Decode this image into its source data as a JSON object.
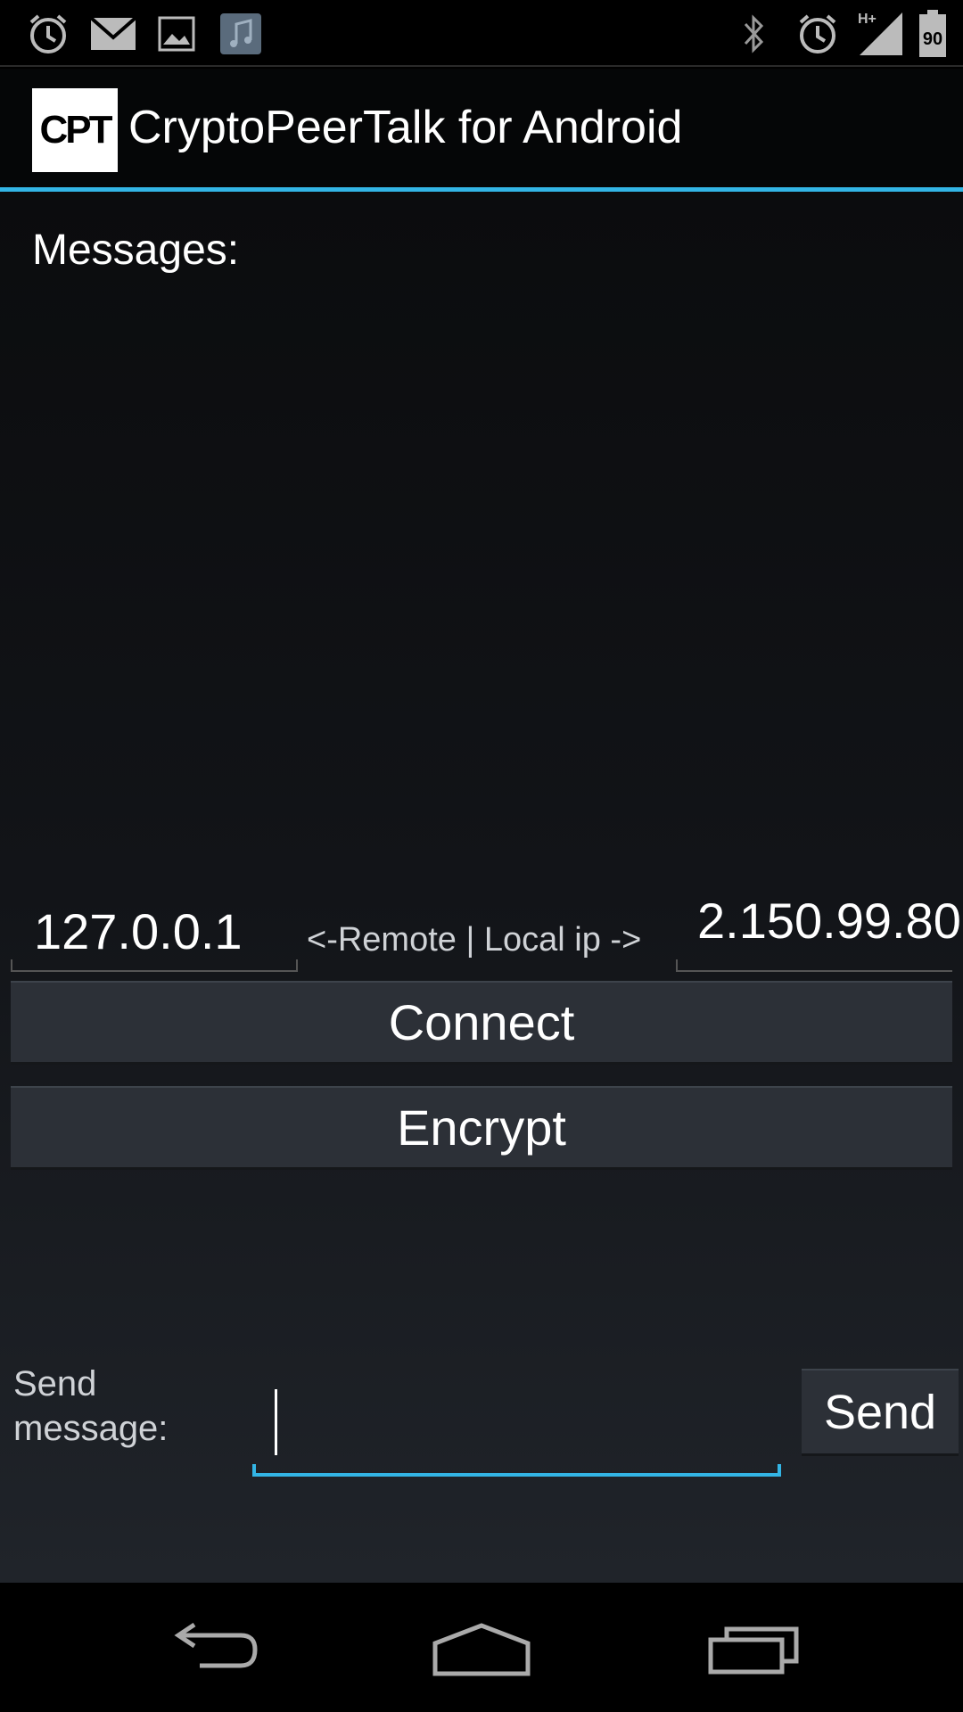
{
  "status_bar": {
    "left_icons": [
      "alarm-icon",
      "gmail-icon",
      "gallery-icon",
      "music-icon"
    ],
    "right_icons": [
      "bluetooth-icon",
      "alarm-icon",
      "signal-icon",
      "battery-icon"
    ],
    "network_type": "H+",
    "battery_level": "90"
  },
  "action_bar": {
    "logo_text": "CPT",
    "title": "CryptoPeerTalk for Android",
    "accent_color": "#33b5e5"
  },
  "main": {
    "messages_label": "Messages:",
    "messages_content": "",
    "remote_ip": "127.0.0.1",
    "ip_separator": "<-Remote | Local ip ->",
    "local_ip": "2.150.99.80",
    "connect_label": "Connect",
    "encrypt_label": "Encrypt",
    "send_message_label": "Send message:",
    "send_input_value": "",
    "send_label": "Send"
  },
  "nav_bar": {
    "icons": [
      "back-icon",
      "home-icon",
      "recents-icon"
    ]
  }
}
